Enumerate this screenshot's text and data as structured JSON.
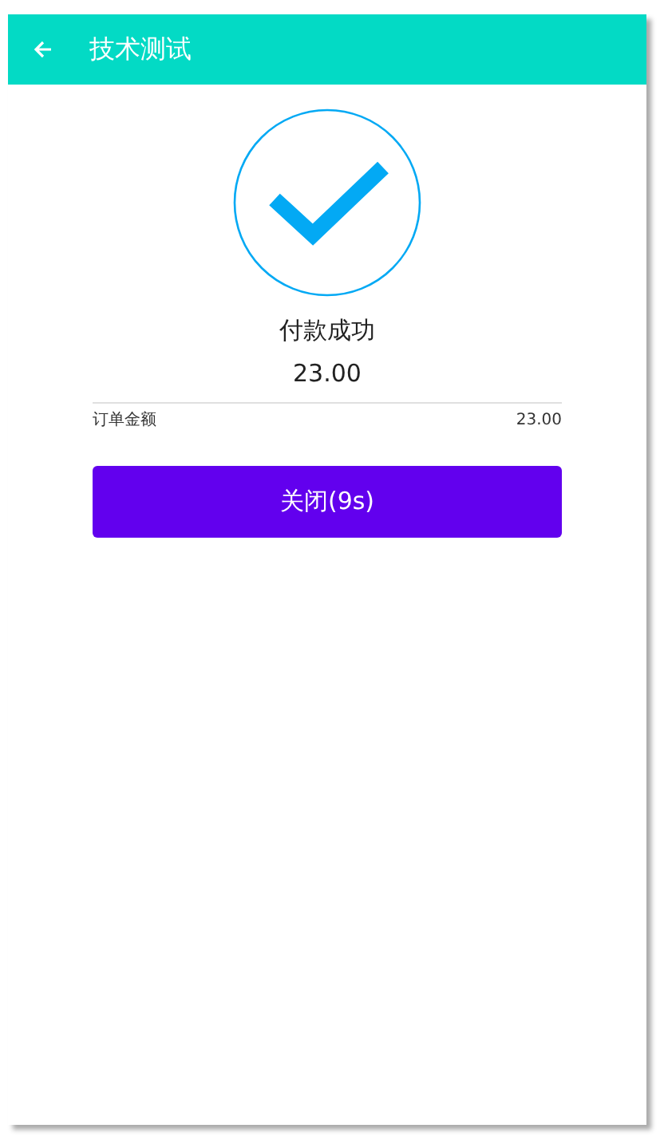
{
  "toolbar": {
    "title": "技术测试"
  },
  "result": {
    "success": true,
    "message": "付款成功",
    "amount": "23.00"
  },
  "details": [
    {
      "label": "订单金额",
      "value": "23.00"
    }
  ],
  "close_button": {
    "label": "关闭(9s)"
  }
}
